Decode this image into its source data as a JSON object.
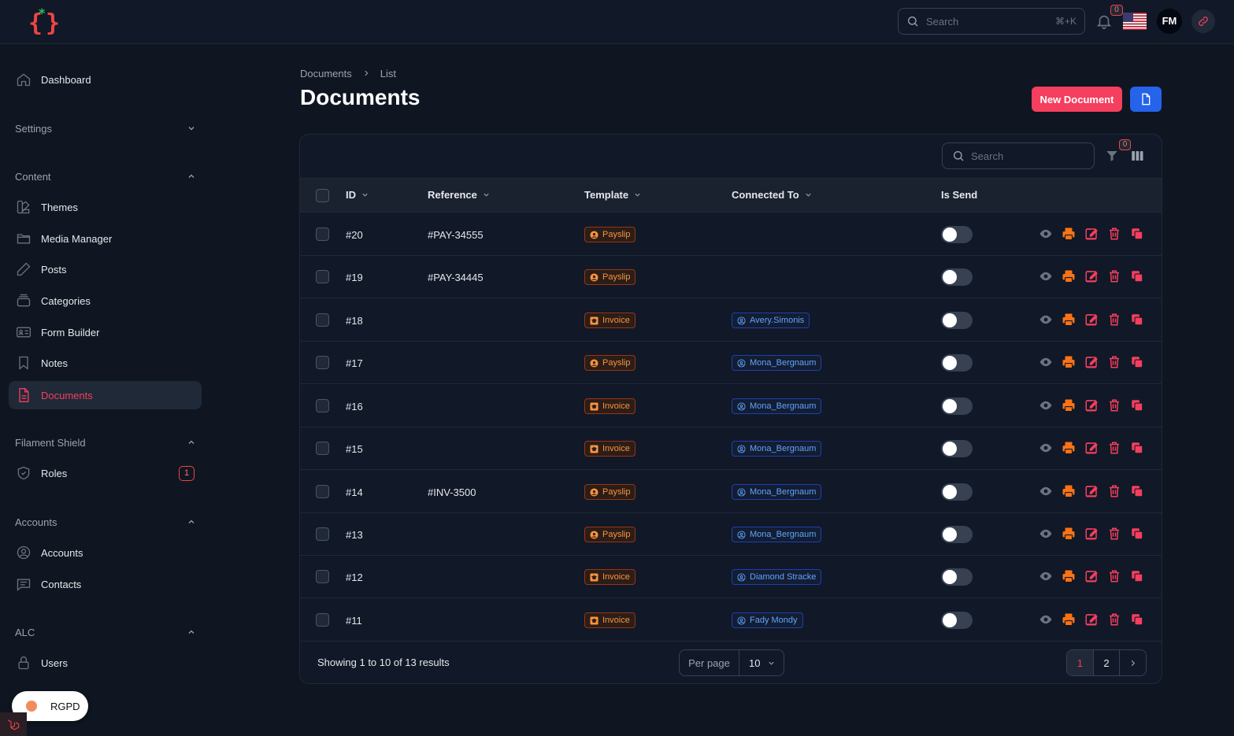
{
  "topbar": {
    "search_placeholder": "Search",
    "search_shortcut": "⌘+K",
    "notifications_count": "0",
    "avatar_initials": "FM"
  },
  "sidebar": {
    "dashboard": "Dashboard",
    "groups": {
      "settings": "Settings",
      "content": "Content",
      "filament_shield": "Filament Shield",
      "accounts": "Accounts",
      "alc": "ALC"
    },
    "items": {
      "themes": "Themes",
      "media_manager": "Media Manager",
      "posts": "Posts",
      "categories": "Categories",
      "form_builder": "Form Builder",
      "notes": "Notes",
      "documents": "Documents",
      "roles": "Roles",
      "roles_badge": "1",
      "accounts": "Accounts",
      "contacts": "Contacts",
      "users": "Users"
    },
    "rgpd": "RGPD"
  },
  "breadcrumb": {
    "root": "Documents",
    "current": "List"
  },
  "page": {
    "title": "Documents",
    "new_button": "New Document"
  },
  "table": {
    "search_placeholder": "Search",
    "filter_count": "0",
    "headers": {
      "id": "ID",
      "reference": "Reference",
      "template": "Template",
      "connected_to": "Connected To",
      "is_send": "Is Send"
    },
    "rows": [
      {
        "id": "#20",
        "reference": "#PAY-34555",
        "template": "Payslip",
        "connected": "",
        "is_send": false
      },
      {
        "id": "#19",
        "reference": "#PAY-34445",
        "template": "Payslip",
        "connected": "",
        "is_send": false
      },
      {
        "id": "#18",
        "reference": "",
        "template": "Invoice",
        "connected": "Avery.Simonis",
        "is_send": false
      },
      {
        "id": "#17",
        "reference": "",
        "template": "Payslip",
        "connected": "Mona_Bergnaum",
        "is_send": false
      },
      {
        "id": "#16",
        "reference": "",
        "template": "Invoice",
        "connected": "Mona_Bergnaum",
        "is_send": false
      },
      {
        "id": "#15",
        "reference": "",
        "template": "Invoice",
        "connected": "Mona_Bergnaum",
        "is_send": false
      },
      {
        "id": "#14",
        "reference": "#INV-3500",
        "template": "Payslip",
        "connected": "Mona_Bergnaum",
        "is_send": false
      },
      {
        "id": "#13",
        "reference": "",
        "template": "Payslip",
        "connected": "Mona_Bergnaum",
        "is_send": false
      },
      {
        "id": "#12",
        "reference": "",
        "template": "Invoice",
        "connected": "Diamond Stracke",
        "is_send": false
      },
      {
        "id": "#11",
        "reference": "",
        "template": "Invoice",
        "connected": "Fady Mondy",
        "is_send": false
      }
    ],
    "footer": {
      "showing": "Showing 1 to 10 of 13 results",
      "per_page_label": "Per page",
      "per_page_value": "10",
      "pages": [
        "1",
        "2"
      ]
    }
  },
  "colors": {
    "accent": "#f43f5e",
    "primary_blue": "#2563eb",
    "badge_orange": "#fb923c",
    "badge_blue": "#60a5fa"
  }
}
